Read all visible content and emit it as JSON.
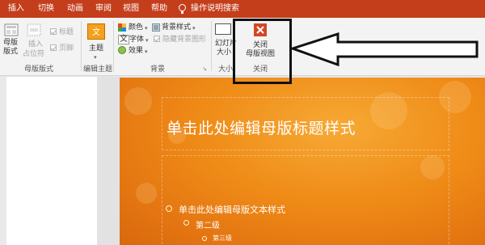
{
  "tabs": [
    {
      "label": "插入"
    },
    {
      "label": "切换"
    },
    {
      "label": "动画"
    },
    {
      "label": "审阅"
    },
    {
      "label": "视图"
    },
    {
      "label": "帮助"
    }
  ],
  "tell_me": "操作说明搜索",
  "ribbon": {
    "master_layout": {
      "master_layout_btn": [
        "母版",
        "版式"
      ],
      "insert_placeholder": [
        "插入",
        "占位符"
      ],
      "title_check": "标题",
      "footer_check": "页脚",
      "group_label": "母版版式"
    },
    "edit_theme": {
      "themes_btn": "主题",
      "group_label": "编辑主题"
    },
    "background": {
      "colors": "颜色",
      "fonts": "字体",
      "effects": "效果",
      "bg_styles": "背景样式",
      "hide_bg": "隐藏背景图形",
      "group_label": "背景"
    },
    "size": {
      "slide_size": [
        "幻灯片",
        "大小"
      ],
      "group_label": "大小"
    },
    "close": {
      "close_master_btn": [
        "关闭",
        "母版视图"
      ],
      "group_label": "关闭"
    }
  },
  "slide": {
    "title": "单击此处编辑母版标题样式",
    "level1": "单击此处编辑母版文本样式",
    "level2": "第二级",
    "level3": "第三级"
  },
  "colors": {
    "tab_bar": "#c43e1c",
    "close_icon": "#d24726",
    "slide_orange": "#ef8b17"
  }
}
